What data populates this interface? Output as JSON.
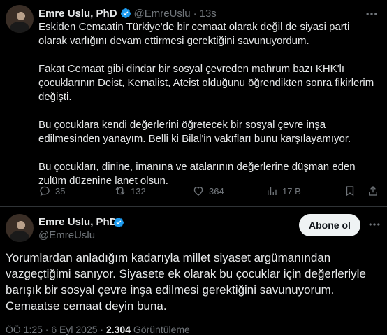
{
  "colors": {
    "background": "#000000",
    "text": "#e7e9ea",
    "muted": "#71767b",
    "verified": "#1d9bf0",
    "divider": "#2f3336"
  },
  "tweet1": {
    "name": "Emre Uslu, PhD",
    "handle": "@EmreUslu",
    "separator": "·",
    "time": "13s",
    "text": "Eskiden Cemaatin Türkiye'de bir cemaat olarak değil de siyasi parti olarak varlığını devam ettirmesi gerektiğini savunuyordum.\n\nFakat Cemaat gibi dindar bir sosyal çevreden mahrum bazı KHK'lı çocuklarının Deist, Kemalist, Ateist olduğunu öğrendikten sonra fikirlerim değişti.\n\nBu çocuklara kendi değerlerini öğretecek bir sosyal çevre inşa edilmesinden yanayım. Belli ki Bilal'in vakıfları bunu karşılayamıyor.\n\nBu çocukları, dinine, imanına ve atalarının değerlerine düşman eden zulüm düzenine lanet olsun.",
    "actions": {
      "replies": "35",
      "reposts": "132",
      "likes": "364",
      "views": "17 B"
    }
  },
  "tweet2": {
    "name": "Emre Uslu, PhD",
    "handle": "@EmreUslu",
    "follow_label": "Abone ol",
    "text": "Yorumlardan anladığım kadarıyla millet siyaset argümanından vazgeçtiğimi sanıyor.  Siyasete ek olarak bu çocuklar için değerleriyle barışık bir sosyal çevre inşa edilmesi gerektiğini savunuyorum. Cemaatse cemaat deyin buna.",
    "timestamp": "ÖÖ 1:25 · 6 Eyl 2025 ·",
    "views_count": "2.304",
    "views_label": "Görüntüleme"
  }
}
